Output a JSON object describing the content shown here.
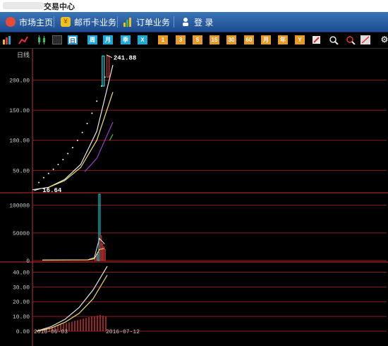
{
  "window": {
    "title_visible": "交易中心"
  },
  "menu": [
    {
      "label": "市场主页",
      "icon": "market-home-icon",
      "color": "#e84a3a"
    },
    {
      "label": "邮币卡业务",
      "icon": "yen-coin-icon",
      "color": "#f0c020"
    },
    {
      "label": "订单业务",
      "icon": "bar-chart-icon",
      "color": "#f0c020"
    },
    {
      "label": "登 录",
      "icon": "login-icon",
      "color": "#ffffff"
    }
  ],
  "toolbar": {
    "period_buttons": [
      "日",
      "周",
      "月",
      "季",
      "X"
    ],
    "selected_period": "日",
    "minute_buttons": [
      "1",
      "3",
      "5",
      "15",
      "30",
      "60",
      "月",
      "年",
      "Y"
    ]
  },
  "chart_data": [
    {
      "type": "line",
      "panel": "price",
      "title": "日线",
      "y_ticks": [
        "200.00",
        "150.00",
        "100.00",
        "50.00"
      ],
      "ylim": [
        20,
        245
      ],
      "x_range": [
        0,
        100
      ],
      "annotations": [
        {
          "label": "241.88",
          "x": 92,
          "y": 241.88,
          "kind": "high"
        },
        {
          "label": "16.64",
          "x": 2,
          "y": 16.64,
          "kind": "low"
        }
      ],
      "series": [
        {
          "name": "",
          "color": "#ffffff",
          "style": "dots",
          "x": [
            8,
            14,
            20,
            26,
            32,
            38,
            44,
            50,
            56,
            62,
            68,
            74,
            80,
            86,
            90
          ],
          "y": [
            30,
            38,
            45,
            52,
            60,
            68,
            78,
            88,
            100,
            113,
            128,
            145,
            165,
            190,
            205
          ]
        },
        {
          "name": "",
          "color": "#e8e8e8",
          "style": "line",
          "x": [
            0,
            20,
            40,
            60,
            80,
            100
          ],
          "y": [
            18,
            22,
            35,
            60,
            115,
            225
          ]
        },
        {
          "name": "",
          "color": "#f0e070",
          "style": "line",
          "x": [
            20,
            40,
            60,
            80,
            100
          ],
          "y": [
            22,
            33,
            55,
            100,
            180
          ]
        },
        {
          "name": "",
          "color": "#9b3fc8",
          "style": "line",
          "x": [
            65,
            80,
            100
          ],
          "y": [
            48,
            70,
            130
          ]
        },
        {
          "name": "",
          "color": "#30c060",
          "style": "line",
          "x": [
            96,
            100
          ],
          "y": [
            100,
            110
          ]
        }
      ],
      "candles": [
        {
          "x": 88,
          "open": 190,
          "close": 240,
          "color": "#1de0e8"
        },
        {
          "x": 94,
          "open": 205,
          "close": 240,
          "color": "#e83030"
        }
      ]
    },
    {
      "type": "bar",
      "panel": "volume",
      "y_ticks": [
        "100000",
        "50000",
        "0"
      ],
      "ylim": [
        0,
        120000
      ],
      "bars": [
        {
          "x": 82,
          "value": 8000,
          "color": "#e83030"
        },
        {
          "x": 84,
          "value": 12000,
          "color": "#e83030"
        },
        {
          "x": 86,
          "value": 15000,
          "color": "#1de0e8"
        },
        {
          "x": 88,
          "value": 120000,
          "color": "#1de0e8"
        },
        {
          "x": 90,
          "value": 45000,
          "color": "#e83030"
        },
        {
          "x": 92,
          "value": 30000,
          "color": "#e83030"
        },
        {
          "x": 94,
          "value": 25000,
          "color": "#e83030"
        },
        {
          "x": 96,
          "value": 20000,
          "color": "#e83030"
        }
      ],
      "lines": [
        {
          "color": "#e8e8e8",
          "x": [
            0,
            70,
            80,
            88,
            96
          ],
          "y": [
            1000,
            1500,
            5000,
            40000,
            30000
          ]
        },
        {
          "color": "#f0e070",
          "x": [
            0,
            70,
            80,
            88,
            96
          ],
          "y": [
            1000,
            1200,
            3000,
            20000,
            22000
          ]
        }
      ]
    },
    {
      "type": "line",
      "panel": "indicator",
      "y_ticks": [
        "40.00",
        "30.00",
        "20.00",
        "10.00",
        "0.00"
      ],
      "ylim": [
        0,
        45
      ],
      "x_tick_labels": [
        {
          "label": "2016-06-03",
          "x": 0
        },
        {
          "label": "2016-07-12",
          "x": 100
        }
      ],
      "series": [
        {
          "name": "",
          "color": "#e8e8e8",
          "x": [
            0,
            20,
            40,
            60,
            80,
            100
          ],
          "y": [
            0,
            3,
            8,
            16,
            28,
            44
          ]
        },
        {
          "name": "",
          "color": "#f0e070",
          "x": [
            0,
            20,
            40,
            60,
            80,
            100
          ],
          "y": [
            0,
            2,
            6,
            12,
            22,
            38
          ]
        }
      ],
      "bars": {
        "color": "#c83030",
        "x": [
          6,
          10,
          14,
          18,
          22,
          26,
          30,
          34,
          38,
          42,
          46,
          50,
          54,
          58,
          62,
          66,
          70,
          74,
          78,
          82,
          86,
          90,
          94,
          98
        ],
        "values": [
          1,
          1.5,
          2,
          2.5,
          3,
          3.5,
          4,
          4.5,
          5,
          5.5,
          6,
          6.5,
          7,
          7.5,
          8,
          8.5,
          9,
          9.5,
          10,
          10,
          10.5,
          11,
          10.5,
          10
        ]
      }
    }
  ]
}
